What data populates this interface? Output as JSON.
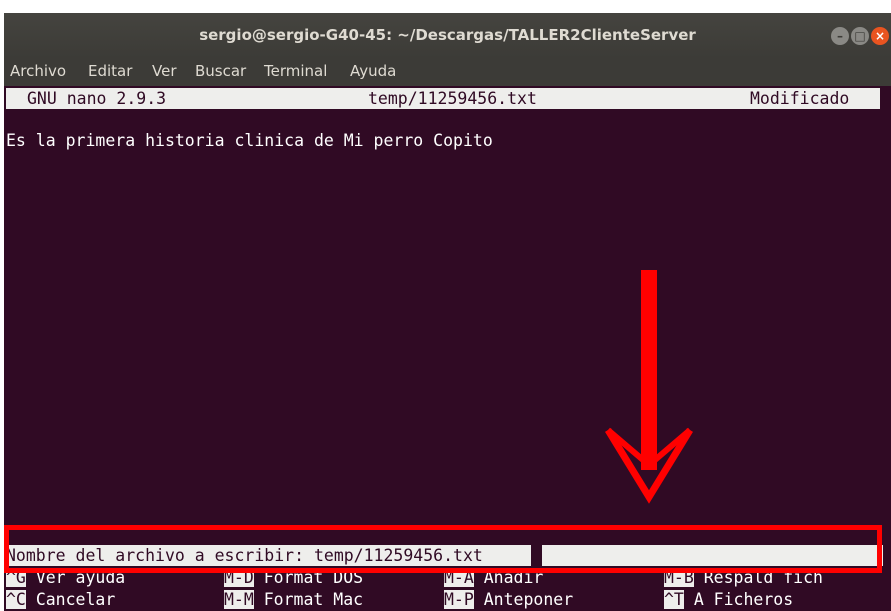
{
  "window": {
    "title": "sergio@sergio-G40-45: ~/Descargas/TALLER2ClienteServer",
    "buttons": [
      "minimize",
      "maximize",
      "close"
    ]
  },
  "menu": [
    "Archivo",
    "Editar",
    "Ver",
    "Buscar",
    "Terminal",
    "Ayuda"
  ],
  "nano": {
    "version": "GNU nano 2.9.3",
    "filename": "temp/11259456.txt",
    "status": "Modificado",
    "content_line": "Es la primera historia clinica de Mi perro Copito",
    "prompt": "Nombre del archivo a escribir: temp/11259456.txt",
    "shortcuts_row1": [
      {
        "key": "^G",
        "label": "Ver ayuda"
      },
      {
        "key": "M-D",
        "label": "Format DOS"
      },
      {
        "key": "M-A",
        "label": "Añadir"
      },
      {
        "key": "M-B",
        "label": "Respald fich"
      }
    ],
    "shortcuts_row2": [
      {
        "key": "^C",
        "label": "Cancelar"
      },
      {
        "key": "M-M",
        "label": "Format Mac"
      },
      {
        "key": "M-P",
        "label": "Anteponer"
      },
      {
        "key": "^T",
        "label": "A Ficheros"
      }
    ]
  },
  "colors": {
    "terminal_bg": "#300a24",
    "highlight_bg": "#eeeeec",
    "annotation_red": "#ff0000"
  }
}
